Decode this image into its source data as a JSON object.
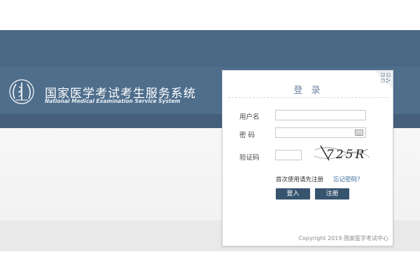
{
  "header": {
    "title_cn": "国家医学考试考生服务系统",
    "title_en": "National Medical Examination Service System"
  },
  "login": {
    "title": "登 录",
    "username_label": "用户名",
    "username_value": "",
    "password_label": "密 码",
    "password_value": "",
    "captcha_label": "验证码",
    "captcha_value": "",
    "captcha_image_text": "725R",
    "first_use_hint": "首次使用请先注册",
    "forgot_link": "忘记密码？",
    "login_button": "登入",
    "register_button": "注册",
    "copyright": "Copyright 2019 国家医学考试中心"
  },
  "colors": {
    "header_band": "#4f6e8c",
    "button": "#37546f",
    "title_text": "#6d86a2",
    "link": "#3a6c9b"
  },
  "icons": {
    "logo": "medical-emblem-icon",
    "qr": "qr-code-icon",
    "keyboard": "keyboard-icon"
  }
}
